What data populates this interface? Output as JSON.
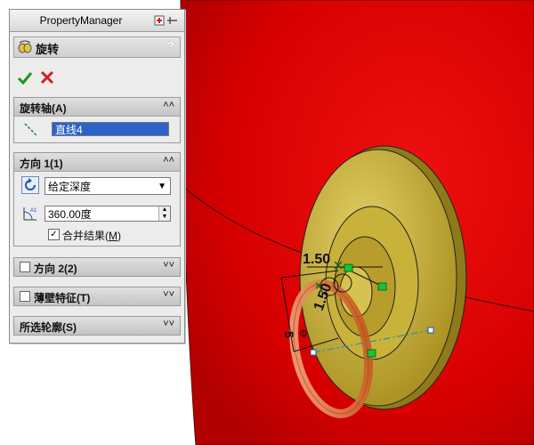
{
  "panel": {
    "title": "PropertyManager",
    "feature_name": "旋转",
    "help": "?"
  },
  "groups": {
    "axis": {
      "title": "旋转轴(A)",
      "value": "直线4"
    },
    "direction1": {
      "title": "方向 1(1)",
      "type": "给定深度",
      "depth": "360.00度",
      "merge_label_pre": "合并结果(",
      "merge_label_key": "M",
      "merge_label_post": ")",
      "merge_checked": "✓"
    },
    "direction2": {
      "title": "方向 2(2)"
    },
    "thin": {
      "title": "薄壁特征(T)"
    },
    "contours": {
      "title": "所选轮廓(S)"
    }
  },
  "sketch_dims": {
    "d1": "1.50",
    "d2": "1.50",
    "d3": "5"
  },
  "colors": {
    "body_red": "#e10000",
    "disc_gold": "#c9b23a",
    "ring_orange": "#e07a3a",
    "sketch_green": "#19c23a",
    "sketch_blue": "#3a7bd5"
  }
}
